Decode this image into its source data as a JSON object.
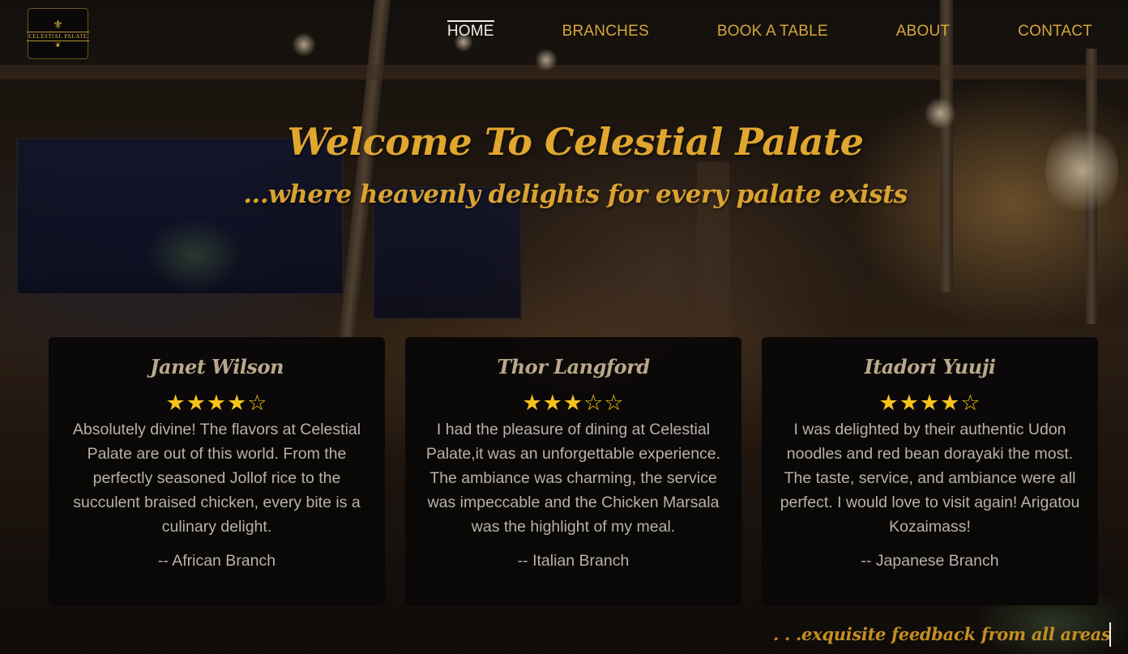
{
  "brand": {
    "logo_text": "CELESTIAL PALATE"
  },
  "nav": {
    "items": [
      {
        "label": "HOME",
        "active": true
      },
      {
        "label": "BRANCHES",
        "active": false
      },
      {
        "label": "BOOK A TABLE",
        "active": false
      },
      {
        "label": "ABOUT",
        "active": false
      },
      {
        "label": "CONTACT",
        "active": false
      }
    ]
  },
  "hero": {
    "title": "Welcome To Celestial Palate",
    "subtitle": "...where heavenly delights for every palate exists"
  },
  "reviews": [
    {
      "name": "Janet Wilson",
      "rating": 4,
      "max_rating": 5,
      "stars": "★★★★☆",
      "text": "Absolutely divine! The flavors at Celestial Palate are out of this world. From the perfectly seasoned Jollof rice to the succulent braised chicken, every bite is a culinary delight.",
      "branch": "-- African Branch"
    },
    {
      "name": "Thor Langford",
      "rating": 3,
      "max_rating": 5,
      "stars": "★★★☆☆",
      "text": "I had the pleasure of dining at Celestial Palate,it was an unforgettable experience. The ambiance was charming, the service was impeccable and the Chicken Marsala was the highlight of my meal.",
      "branch": "-- Italian Branch"
    },
    {
      "name": "Itadori Yuuji",
      "rating": 4,
      "max_rating": 5,
      "stars": "★★★★☆",
      "text": "I was delighted by their authentic Udon noodles and red bean dorayaki the most. The taste, service, and ambiance were all perfect. I would love to visit again! Arigatou Kozaimass!",
      "branch": "-- Japanese Branch"
    }
  ],
  "footer": {
    "tagline": ". . .exquisite feedback from all areas"
  },
  "colors": {
    "accent_gold": "#d6a63a",
    "star_yellow": "#f7c21a",
    "card_bg": "#080707",
    "nav_active": "#f2efe9"
  }
}
